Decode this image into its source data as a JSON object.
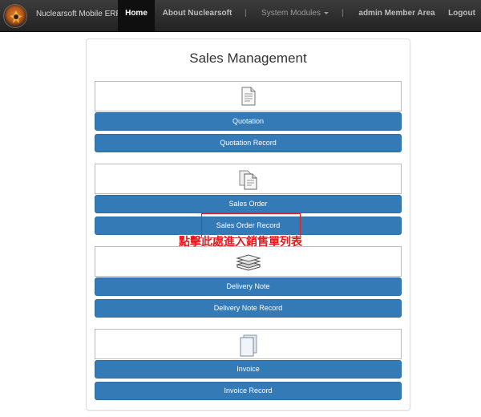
{
  "navbar": {
    "brand": "Nuclearsoft Mobile ERP",
    "home": "Home",
    "about": "About Nuclearsoft",
    "separator": "|",
    "modules": "System Modules",
    "member": "admin Member Area",
    "logout": "Logout"
  },
  "page": {
    "title": "Sales Management"
  },
  "sections": {
    "quotation": {
      "icon": "document-icon",
      "primary": "Quotation",
      "record": "Quotation Record"
    },
    "sales_order": {
      "icon": "documents-copy-icon",
      "primary": "Sales Order",
      "record": "Sales Order Record"
    },
    "delivery_note": {
      "icon": "stacked-items-icon",
      "primary": "Delivery Note",
      "record": "Delivery Note Record"
    },
    "invoice": {
      "icon": "invoice-pages-icon",
      "primary": "Invoice",
      "record": "Invoice Record"
    }
  },
  "annotation": {
    "text": "點擊此處進入銷售單列表"
  },
  "colors": {
    "navbar": "#222222",
    "button": "#337ab7",
    "annotation": "#e8161a"
  }
}
